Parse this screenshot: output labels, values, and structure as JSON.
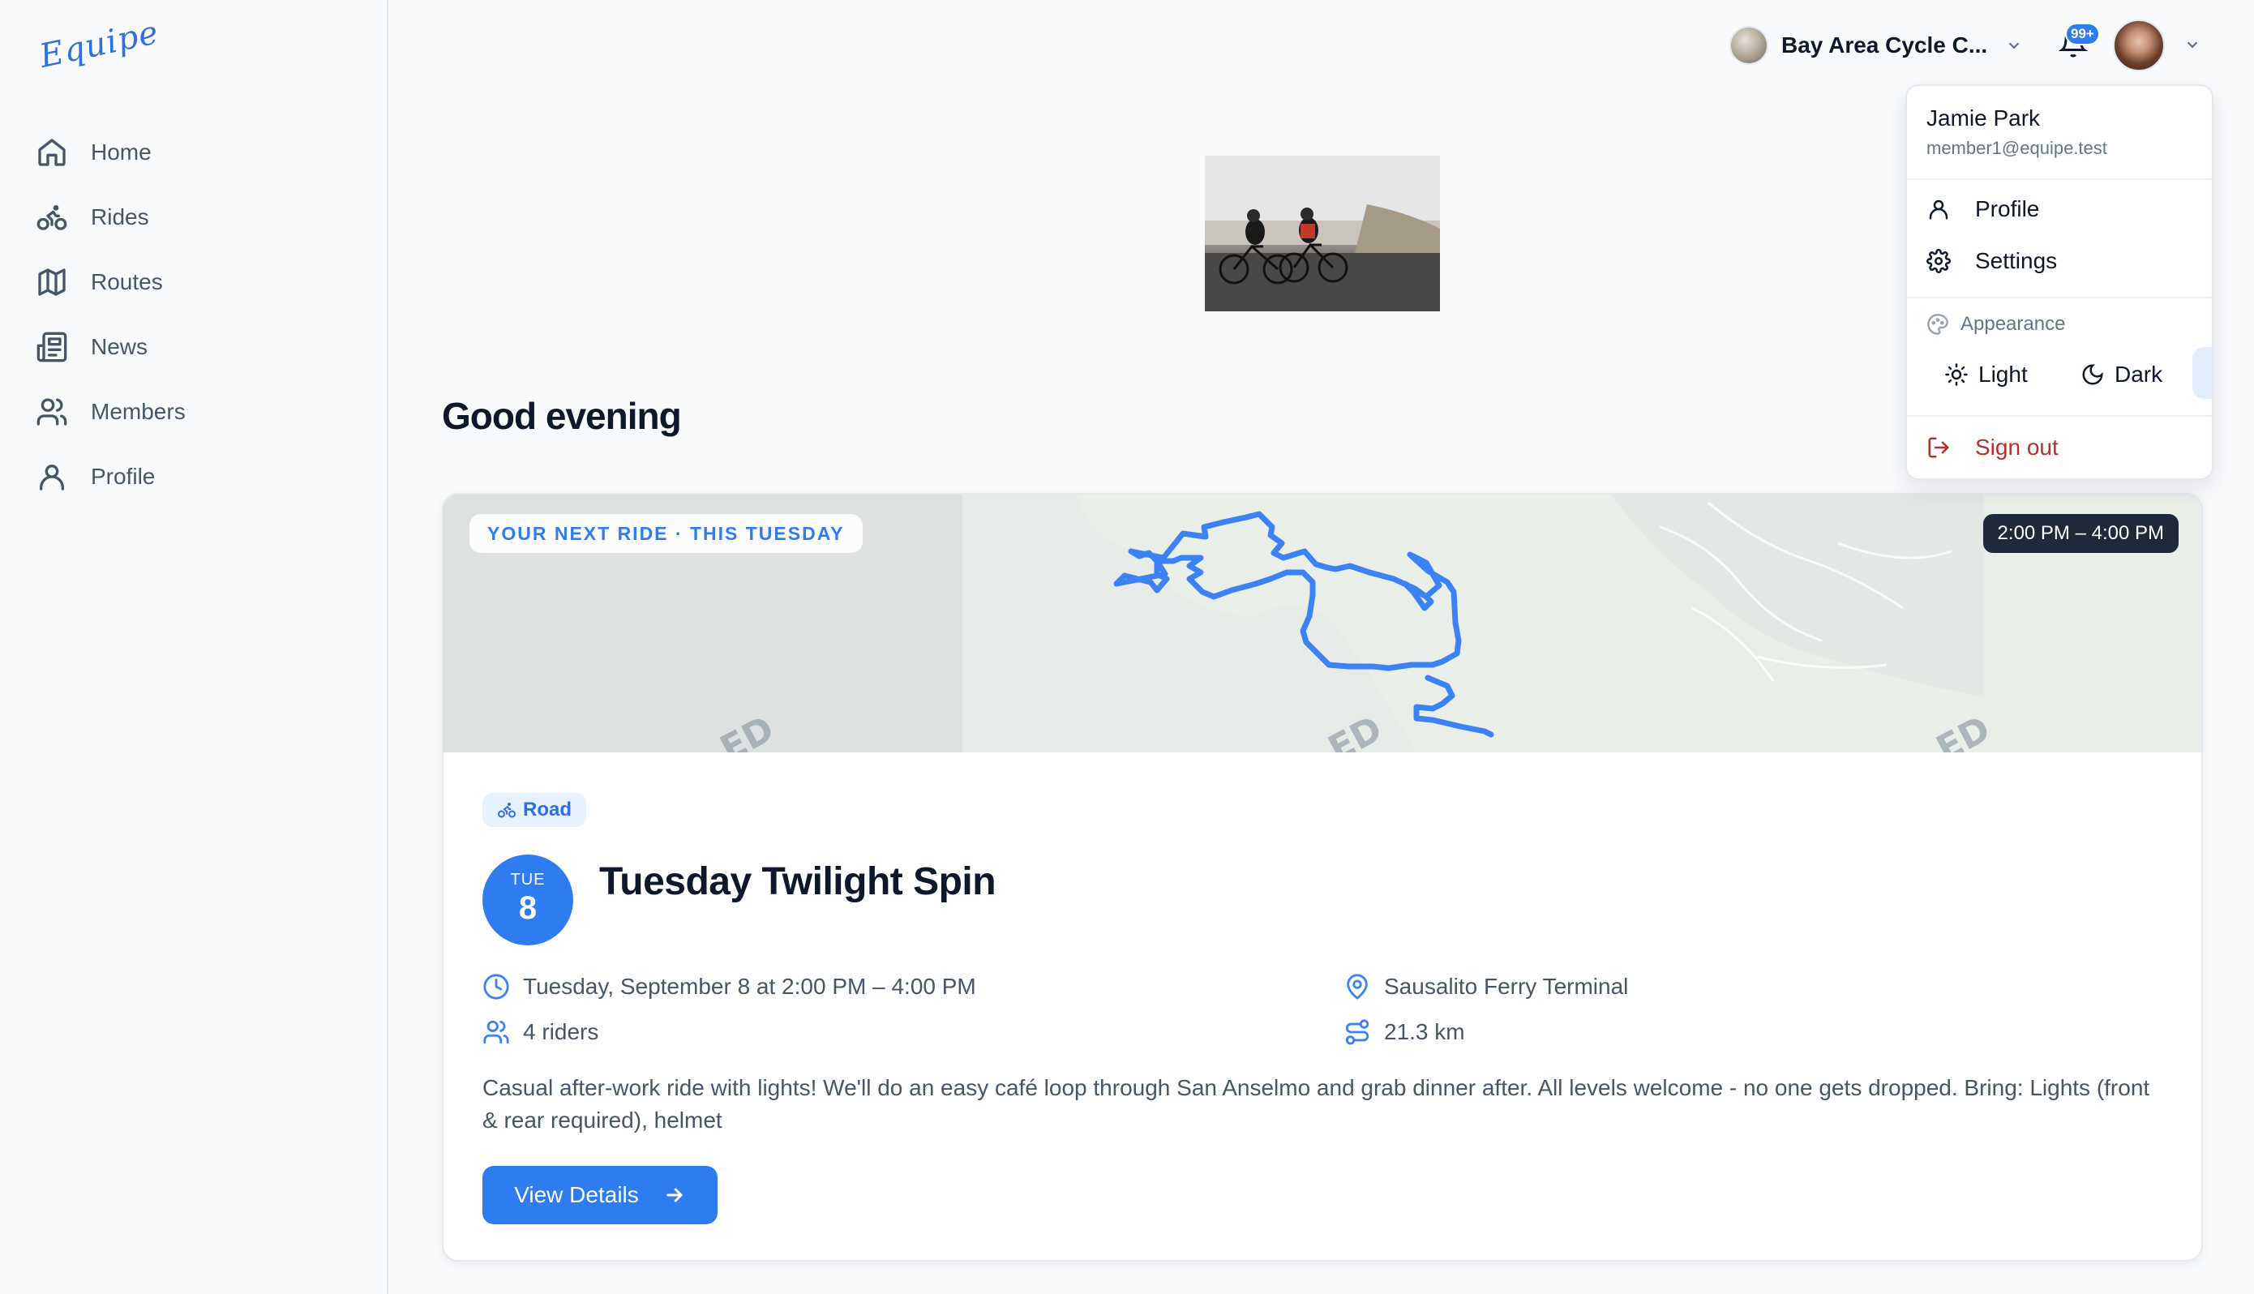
{
  "app": {
    "logo_text": "Equipe"
  },
  "sidebar": {
    "items": [
      {
        "label": "Home",
        "icon": "home-icon"
      },
      {
        "label": "Rides",
        "icon": "bike-icon"
      },
      {
        "label": "Routes",
        "icon": "map-icon"
      },
      {
        "label": "News",
        "icon": "newspaper-icon"
      },
      {
        "label": "Members",
        "icon": "users-icon"
      },
      {
        "label": "Profile",
        "icon": "user-icon"
      }
    ]
  },
  "header": {
    "club_name": "Bay Area Cycle C...",
    "notification_count": "99+"
  },
  "user_menu": {
    "name": "Jamie Park",
    "email": "member1@equipe.test",
    "profile_label": "Profile",
    "settings_label": "Settings",
    "appearance_label": "Appearance",
    "light_label": "Light",
    "dark_label": "Dark",
    "signout_label": "Sign out"
  },
  "greeting": "Good evening",
  "next_ride": {
    "banner": "YOUR NEXT RIDE · THIS TUESDAY",
    "time_range": "2:00 PM – 4:00 PM",
    "tag": "Road",
    "date_dow": "TUE",
    "date_day": "8",
    "title": "Tuesday Twilight Spin",
    "datetime": "Tuesday, September 8 at 2:00 PM – 4:00 PM",
    "location": "Sausalito Ferry Terminal",
    "riders": "4 riders",
    "distance": "21.3 km",
    "description": "Casual after-work ride with lights! We'll do an easy café loop through San Anselmo and grab dinner after. All levels welcome - no one gets dropped. Bring: Lights (front & rear required), helmet",
    "button_label": "View Details"
  },
  "colors": {
    "accent": "#2f7cf0",
    "route": "#3b82f6",
    "danger": "#b4302c"
  }
}
